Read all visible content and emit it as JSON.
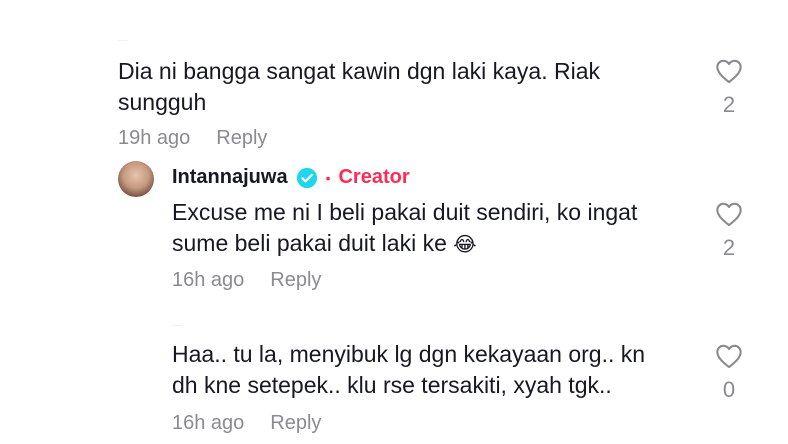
{
  "comments": [
    {
      "text_line1": "Dia ni bangga sangat kawin dgn laki kaya. Riak",
      "text_line2": "sungguh",
      "time": "19h ago",
      "reply_label": "Reply",
      "likes": "2"
    },
    {
      "author": "Intannajuwa",
      "badge": "Creator",
      "text_line1": "Excuse me ni I beli pakai duit sendiri, ko ingat",
      "text_line2": "sume beli pakai duit laki ke",
      "emoji": "😂",
      "time": "16h ago",
      "reply_label": "Reply",
      "likes": "2"
    },
    {
      "text_line1": "Haa.. tu la, menyibuk lg dgn kekayaan org.. kn",
      "text_line2": "dh kne setepek.. klu rse tersakiti, xyah tgk..",
      "time": "16h ago",
      "reply_label": "Reply",
      "likes": "0"
    }
  ],
  "colors": {
    "text": "#161823",
    "muted": "#8a8b91",
    "creator": "#fe2c55",
    "verified": "#20d5ec"
  },
  "icons": {
    "like": "heart-outline-icon",
    "verified": "verified-check-icon"
  }
}
